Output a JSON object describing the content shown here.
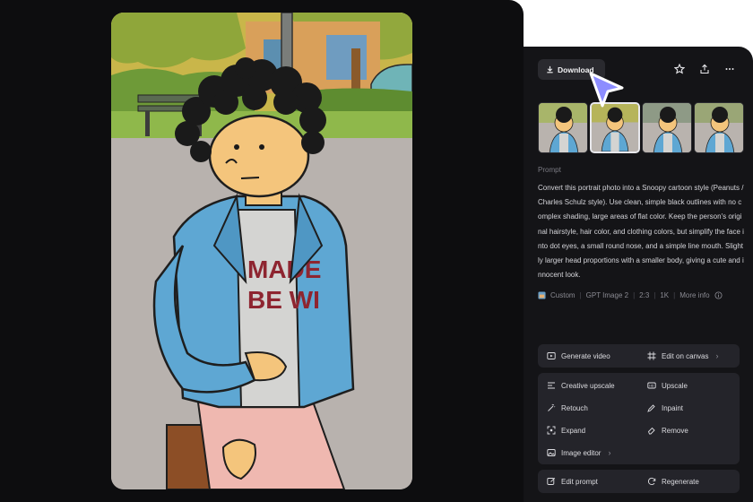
{
  "toolbar": {
    "download_label": "Download",
    "icons": [
      "download-icon",
      "star-icon",
      "share-icon",
      "more-icon"
    ]
  },
  "prompt": {
    "label": "Prompt",
    "text": "Convert this portrait photo into a Snoopy cartoon style (Peanuts / Charles Schulz style). Use clean, simple black outlines with no complex shading, large areas of flat color. Keep the person's original hairstyle, hair color, and clothing colors, but simplify the face into dot eyes, a small round nose, and a simple line mouth. Slightly larger head proportions with a smaller body, giving a cute and innocent look."
  },
  "meta": {
    "style": "Custom",
    "model": "GPT Image 2",
    "ratio": "2:3",
    "resolution": "1K",
    "more": "More info"
  },
  "actions": {
    "generate_video": "Generate video",
    "edit_on_canvas": "Edit on canvas",
    "creative_upscale": "Creative upscale",
    "upscale": "Upscale",
    "retouch": "Retouch",
    "inpaint": "Inpaint",
    "expand": "Expand",
    "remove": "Remove",
    "image_editor": "Image editor",
    "edit_prompt": "Edit prompt",
    "regenerate": "Regenerate"
  },
  "main_image": {
    "shirt_text_line1": "MADE",
    "shirt_text_line2": "BE WI"
  },
  "colors": {
    "panel_dark": "#0d0d0f",
    "panel_right": "#141417",
    "button_bg": "#24242a",
    "cursor_accent": "#8d8dff"
  },
  "thumbnails": {
    "count": 4,
    "selected_index": 1
  }
}
